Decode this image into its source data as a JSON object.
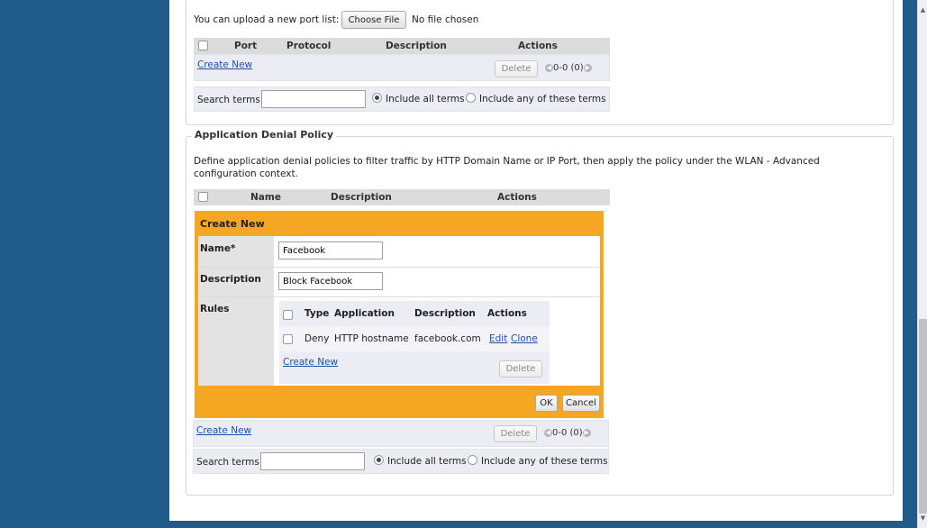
{
  "port_list": {
    "upload_label": "You can upload a new port list:",
    "choose_file": "Choose File",
    "no_file": "No file chosen",
    "columns": [
      "Port",
      "Protocol",
      "Description",
      "Actions"
    ],
    "create_new": "Create New",
    "delete": "Delete",
    "pager": "0-0 (0)",
    "search_label": "Search terms",
    "include_all": "Include all terms",
    "include_any": "Include any of these terms"
  },
  "app_denial": {
    "legend": "Application Denial Policy",
    "description": "Define application denial policies to filter traffic by HTTP Domain Name or IP Port, then apply the policy under the WLAN - Advanced configuration context.",
    "columns": [
      "Name",
      "Description",
      "Actions"
    ],
    "create_form": {
      "title": "Create New",
      "name_label": "Name*",
      "name_value": "Facebook",
      "description_label": "Description",
      "description_value": "Block Facebook",
      "rules_label": "Rules",
      "rules_columns": [
        "Type",
        "Application",
        "Description",
        "Actions"
      ],
      "rules": [
        {
          "type": "Deny",
          "application": "HTTP hostname",
          "description": "facebook.com",
          "edit": "Edit",
          "clone": "Clone"
        }
      ],
      "rules_create_new": "Create New",
      "rules_delete": "Delete",
      "ok": "OK",
      "cancel": "Cancel"
    },
    "create_new": "Create New",
    "delete": "Delete",
    "pager": "0-0 (0)",
    "search_label": "Search terms",
    "include_all": "Include all terms",
    "include_any": "Include any of these terms"
  },
  "icons": {
    "prev": "prev-arrow-icon",
    "next": "next-arrow-icon"
  },
  "colors": {
    "frame_blue": "#215b8c",
    "form_orange": "#f5a623",
    "link_blue": "#1d4fa8"
  }
}
